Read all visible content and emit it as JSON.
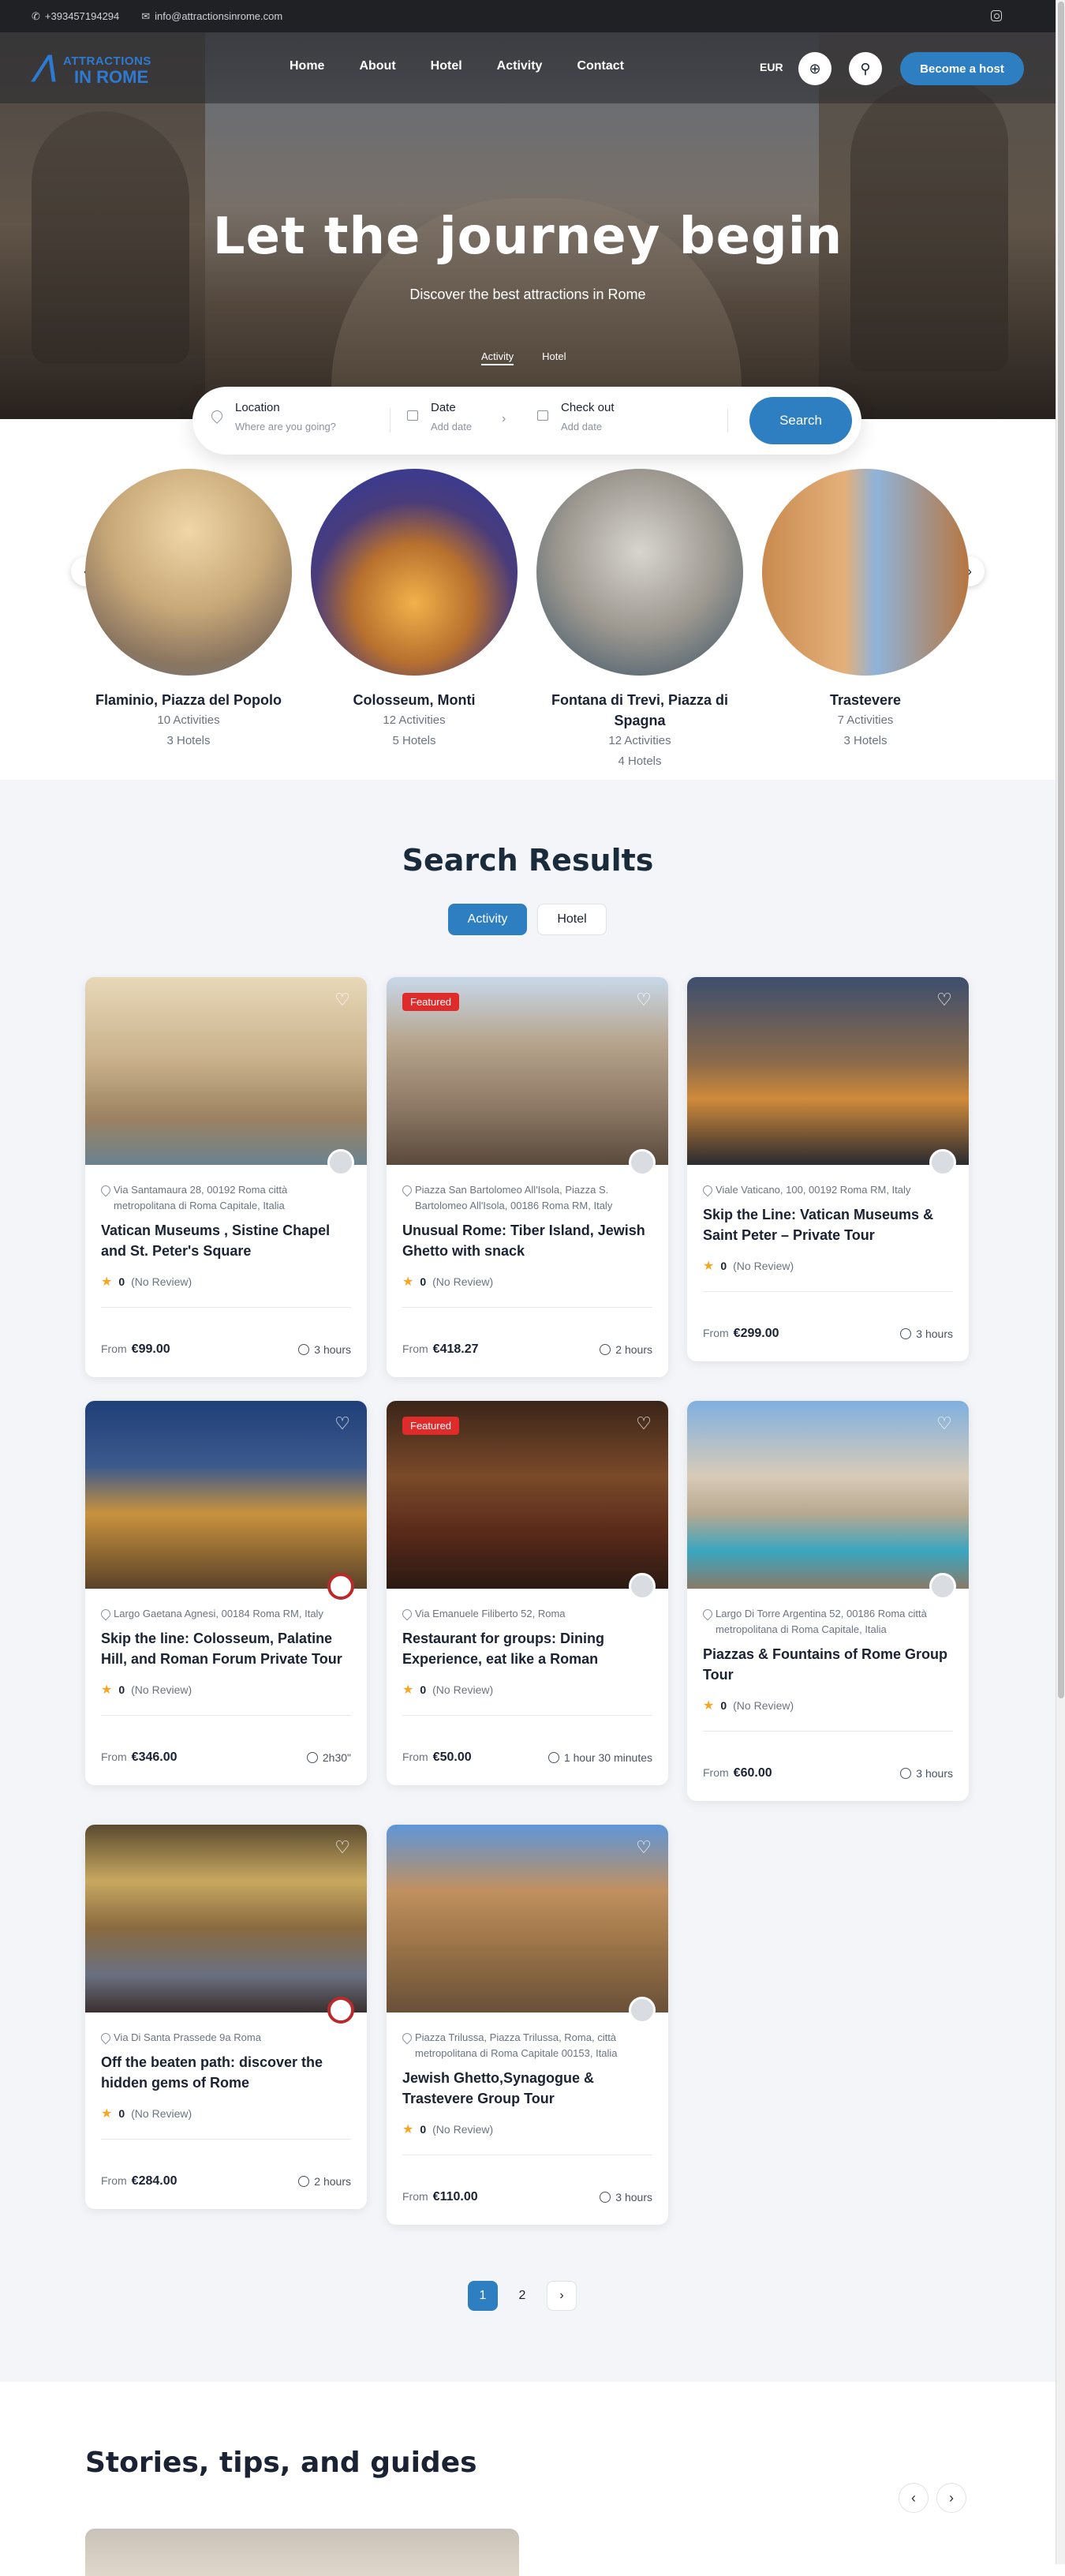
{
  "topbar": {
    "phone": "+393457194294",
    "email": "info@attractionsinrome.com"
  },
  "logo": {
    "line1": "ATTRACTIONS",
    "line2": "IN ROME"
  },
  "nav": {
    "items": [
      "Home",
      "About",
      "Hotel",
      "Activity",
      "Contact"
    ],
    "currency": "EUR",
    "host_button": "Become a host"
  },
  "hero": {
    "title": "Let the journey begin",
    "subtitle": "Discover the best attractions in Rome",
    "tabs": [
      "Activity",
      "Hotel"
    ]
  },
  "search": {
    "location_label": "Location",
    "location_placeholder": "Where are you going?",
    "date_label": "Date",
    "date_placeholder": "Add date",
    "checkout_label": "Check out",
    "checkout_placeholder": "Add date",
    "button": "Search"
  },
  "destinations": [
    {
      "name": "Flaminio, Piazza del Popolo",
      "activities": "10 Activities",
      "hotels": "3 Hotels"
    },
    {
      "name": "Colosseum, Monti",
      "activities": "12 Activities",
      "hotels": "5 Hotels"
    },
    {
      "name": "Fontana di Trevi, Piazza di Spagna",
      "activities": "12 Activities",
      "hotels": "4 Hotels"
    },
    {
      "name": "Trastevere",
      "activities": "7 Activities",
      "hotels": "3 Hotels"
    }
  ],
  "results": {
    "title": "Search Results",
    "tabs": [
      "Activity",
      "Hotel"
    ],
    "from_label": "From",
    "rating_value": "0",
    "review_label": "(No Review)",
    "featured_label": "Featured",
    "cards": [
      {
        "address": "Via Santamaura 28, 00192 Roma città metropolitana di Roma Capitale, Italia",
        "title": "Vatican Museums , Sistine Chapel and St. Peter's Square",
        "price": "€99.00",
        "duration": "3 hours"
      },
      {
        "address": "Piazza San Bartolomeo All'Isola, Piazza S. Bartolomeo All'Isola, 00186 Roma RM, Italy",
        "title": "Unusual Rome: Tiber Island, Jewish Ghetto with snack",
        "price": "€418.27",
        "duration": "2 hours"
      },
      {
        "address": "Viale Vaticano, 100, 00192 Roma RM, Italy",
        "title": "Skip the Line: Vatican Museums & Saint Peter – Private Tour",
        "price": "€299.00",
        "duration": "3 hours"
      },
      {
        "address": "Largo Gaetana Agnesi, 00184 Roma RM, Italy",
        "title": "Skip the line: Colosseum, Palatine Hill, and Roman Forum Private Tour",
        "price": "€346.00",
        "duration": "2h30\""
      },
      {
        "address": "Via Emanuele Filiberto 52, Roma",
        "title": "Restaurant for groups: Dining Experience, eat like a Roman",
        "price": "€50.00",
        "duration": "1 hour 30 minutes"
      },
      {
        "address": "Largo Di Torre Argentina 52, 00186 Roma città metropolitana di Roma Capitale, Italia",
        "title": "Piazzas & Fountains of Rome Group Tour",
        "price": "€60.00",
        "duration": "3 hours"
      },
      {
        "address": "Via Di Santa Prassede 9a Roma",
        "title": "Off the beaten path: discover the hidden gems of Rome",
        "price": "€284.00",
        "duration": "2 hours"
      },
      {
        "address": "Piazza Trilussa, Piazza Trilussa, Roma, città metropolitana di Roma Capitale 00153, Italia",
        "title": "Jewish Ghetto,Synagogue & Trastevere Group Tour",
        "price": "€110.00",
        "duration": "3 hours"
      }
    ]
  },
  "pagination": {
    "pages": [
      "1",
      "2"
    ],
    "next": "›"
  },
  "stories": {
    "title": "Stories, tips, and guides"
  },
  "colors": {
    "accent": "#2d7fc1",
    "featured": "#e02b2b",
    "star": "#f5a623"
  }
}
